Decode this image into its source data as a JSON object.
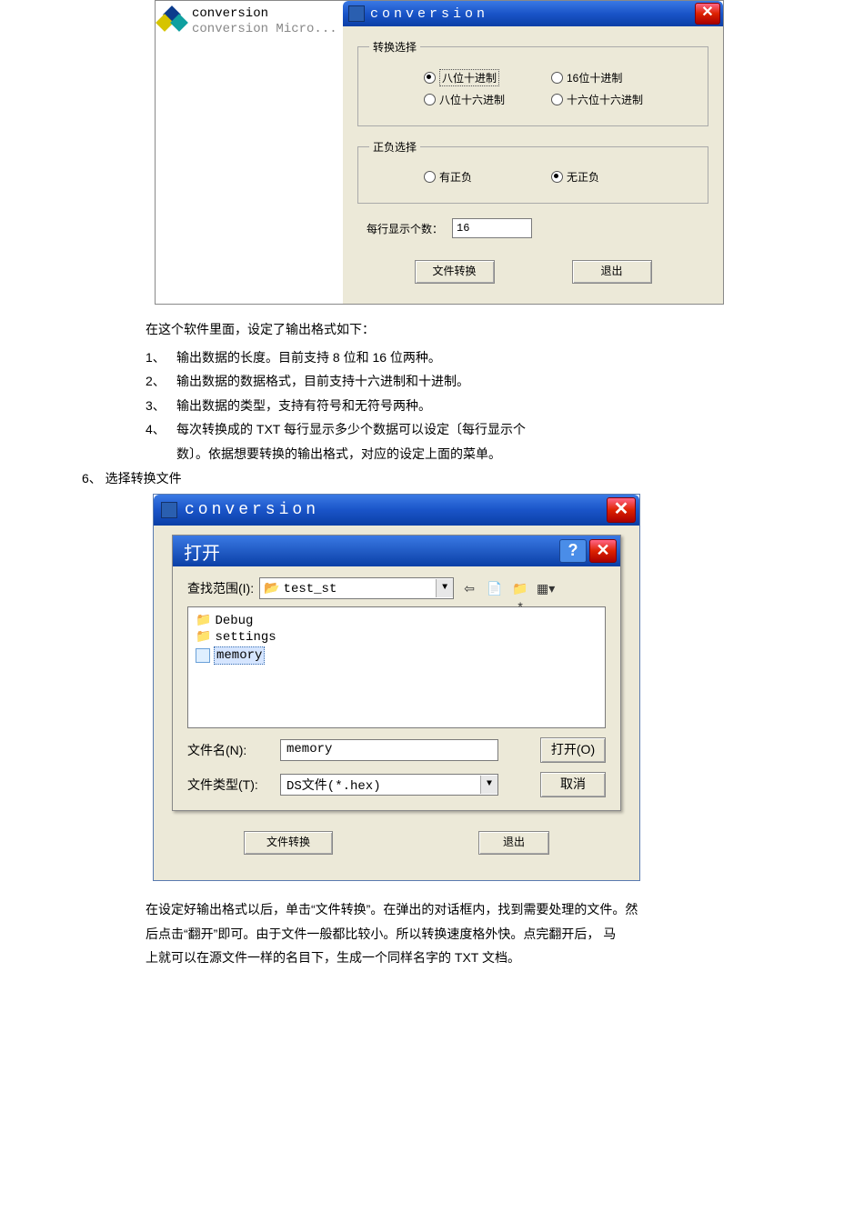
{
  "shot1": {
    "left": {
      "line1": "conversion",
      "line2": "conversion Micro..."
    },
    "title": "conversion",
    "group1": {
      "legend": "转换选择",
      "opts": [
        "八位十进制",
        "16位十进制",
        "八位十六进制",
        "十六位十六进制"
      ],
      "selected": 0
    },
    "group2": {
      "legend": "正负选择",
      "opts": [
        "有正负",
        "无正负"
      ],
      "selected": 1
    },
    "count_label": "每行显示个数：",
    "count_value": "16",
    "btn_convert": "文件转换",
    "btn_exit": "退出"
  },
  "text1": {
    "intro": "在这个软件里面，设定了输出格式如下：",
    "items": [
      "输出数据的长度。目前支持 8 位和 16 位两种。",
      "输出数据的数据格式，目前支持十六进制和十进制。",
      "输出数据的类型，支持有符号和无符号两种。",
      "每次转换成的 TXT 每行显示多少个数据可以设定〔每行显示个"
    ],
    "cont": "数〕。依据想要转换的输出格式，对应的设定上面的菜单。",
    "outer6": "6、 选择转换文件"
  },
  "shot2": {
    "title": "conversion",
    "dlg_title": "打开",
    "lookin_label": "查找范围(I):",
    "lookin_value": "test_st",
    "files": [
      {
        "type": "folder",
        "name": "Debug"
      },
      {
        "type": "folder",
        "name": "settings"
      },
      {
        "type": "file",
        "name": "memory",
        "selected": true
      }
    ],
    "fname_label": "文件名(N):",
    "fname_value": "memory",
    "ftype_label": "文件类型(T):",
    "ftype_value": "DS文件(*.hex)",
    "btn_open": "打开(O)",
    "btn_cancel": "取消",
    "btn_convert": "文件转换",
    "btn_exit": "退出"
  },
  "text2": {
    "p1": "在设定好输出格式以后，单击“文件转换”。在弹出的对话框内，找到需要处理的文件。然",
    "p2": "后点击“翻开”即可。由于文件一般都比较小。所以转换速度格外快。点完翻开后，  马",
    "p3": "上就可以在源文件一样的名目下，生成一个同样名字的 TXT 文档。"
  }
}
